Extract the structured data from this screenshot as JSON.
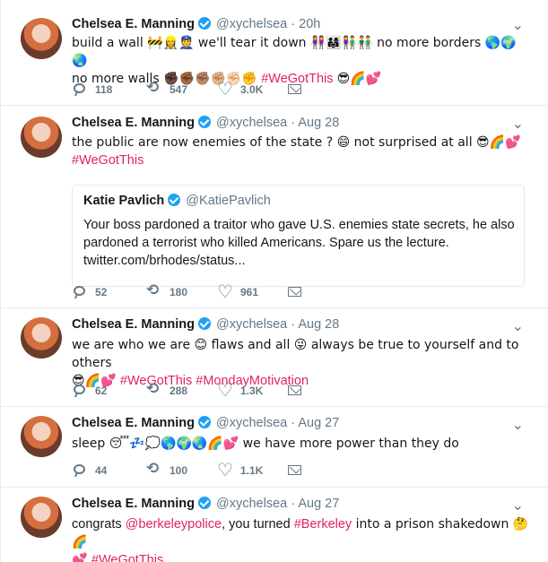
{
  "tweets": [
    {
      "name": "Chelsea E. Manning",
      "handle": "@xychelsea",
      "time": "20h",
      "text_1": "build a wall 🚧👷‍♀️👮 we'll tear it down 👭👨‍👩‍👧👫👬 no more borders 🌎🌍🌏",
      "text_2": "no more walls ✊🏿✊🏾✊🏽✊🏼✊🏻✊ ",
      "hashtag": "#WeGotThis",
      "emoji_tail": "😎🌈💕",
      "replies": "118",
      "retweets": "547",
      "likes": "3.0K"
    },
    {
      "name": "Chelsea E. Manning",
      "handle": "@xychelsea",
      "time": "Aug 28",
      "text_1": "the public are now enemies of the state ? 😄 not surprised at all 😎🌈💕",
      "hashtag": "#WeGotThis",
      "quote": {
        "name": "Katie Pavlich",
        "handle": "@KatiePavlich",
        "text": "Your boss pardoned a traitor who gave U.S. enemies state secrets, he also pardoned a terrorist who killed Americans. Spare us the lecture. twitter.com/brhodes/status..."
      },
      "replies": "52",
      "retweets": "180",
      "likes": "961"
    },
    {
      "name": "Chelsea E. Manning",
      "handle": "@xychelsea",
      "time": "Aug 28",
      "text_1": "we are who we are 😊 flaws and all 😜 always be true to yourself and to others",
      "text_2": "😎🌈💕 ",
      "hashtag": "#WeGotThis",
      "hashtag_2": "#MondayMotivation",
      "replies": "62",
      "retweets": "288",
      "likes": "1.3K"
    },
    {
      "name": "Chelsea E. Manning",
      "handle": "@xychelsea",
      "time": "Aug 27",
      "text_1": "sleep 😴💤💭🌎🌍🌏🌈💕 we have more power than they do",
      "replies": "44",
      "retweets": "100",
      "likes": "1.1K"
    },
    {
      "name": "Chelsea E. Manning",
      "handle": "@xychelsea",
      "time": "Aug 27",
      "text_pre": "congrats ",
      "mention": "@berkeleypolice",
      "text_mid": ", you turned ",
      "hashtag_topic": "#Berkeley",
      "text_post": " into a prison shakedown 🤔🌈",
      "text_2": "💕 ",
      "hashtag": "#WeGotThis"
    }
  ]
}
